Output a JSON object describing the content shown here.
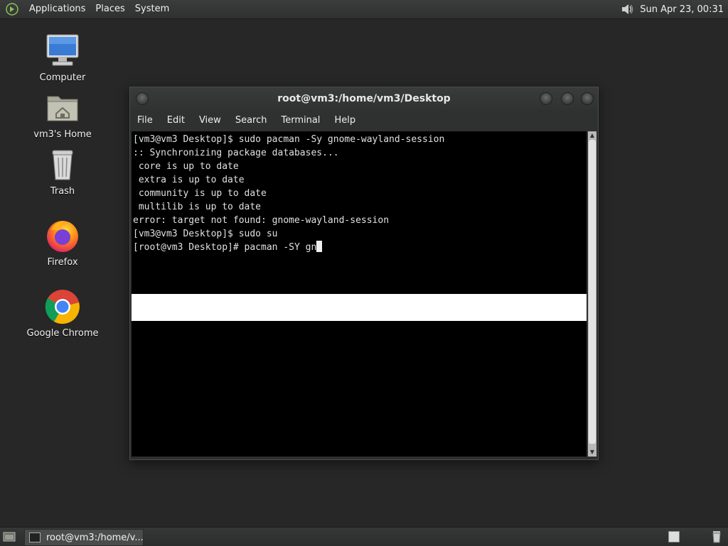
{
  "top_panel": {
    "menus": [
      "Applications",
      "Places",
      "System"
    ],
    "clock": "Sun Apr 23, 00:31",
    "volume_icon": "volume-icon"
  },
  "desktop": {
    "icons": [
      {
        "label": "Computer",
        "icon": "computer-icon"
      },
      {
        "label": "vm3's Home",
        "icon": "home-folder-icon"
      },
      {
        "label": "Trash",
        "icon": "trash-icon"
      },
      {
        "label": "Firefox",
        "icon": "firefox-icon"
      },
      {
        "label": "Google Chrome",
        "icon": "chrome-icon"
      }
    ]
  },
  "terminal": {
    "title": "root@vm3:/home/vm3/Desktop",
    "menus": [
      "File",
      "Edit",
      "View",
      "Search",
      "Terminal",
      "Help"
    ],
    "lines": [
      "[vm3@vm3 Desktop]$ sudo pacman -Sy gnome-wayland-session",
      ":: Synchronizing package databases...",
      " core is up to date",
      " extra is up to date",
      " community is up to date",
      " multilib is up to date",
      "error: target not found: gnome-wayland-session",
      "[vm3@vm3 Desktop]$ sudo su",
      "[root@vm3 Desktop]# pacman -SY gn"
    ]
  },
  "taskbar": {
    "task_label": "root@vm3:/home/v..."
  },
  "colors": {
    "desktop_bg": "#262726",
    "panel_bg": "#333534",
    "terminal_bg": "#000000",
    "terminal_fg": "#e0e0e0"
  }
}
